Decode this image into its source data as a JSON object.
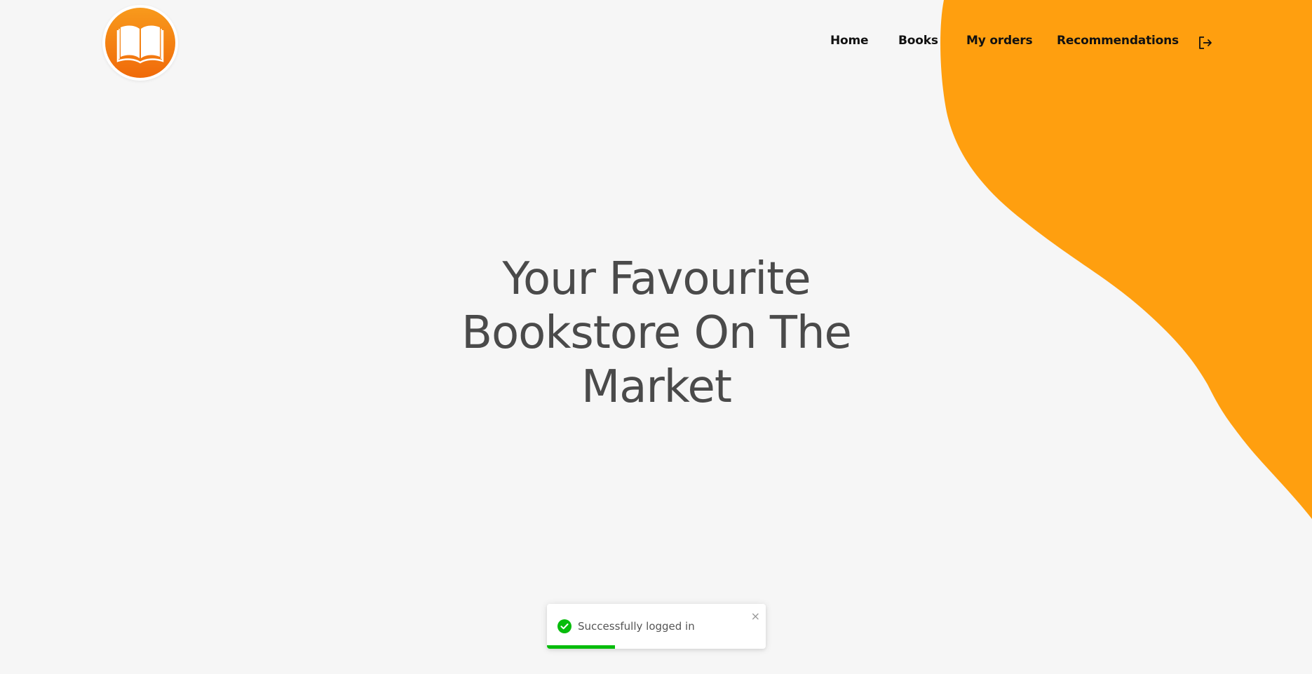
{
  "colors": {
    "accent": "#ff9f0f",
    "background": "#f6f6f6",
    "toast_success": "#07bc0c"
  },
  "header": {
    "logo_icon": "open-book-icon",
    "nav": [
      {
        "label": "Home"
      },
      {
        "label": "Books"
      },
      {
        "label": "My orders"
      },
      {
        "label": "Recommendations"
      }
    ],
    "logout_icon": "logout-icon"
  },
  "hero": {
    "line1": "Your Favourite",
    "line2": "Bookstore On The",
    "line3": "Market"
  },
  "toast": {
    "icon": "check-circle-icon",
    "message": "Successfully logged in",
    "close": "×",
    "progress": 0.31
  }
}
